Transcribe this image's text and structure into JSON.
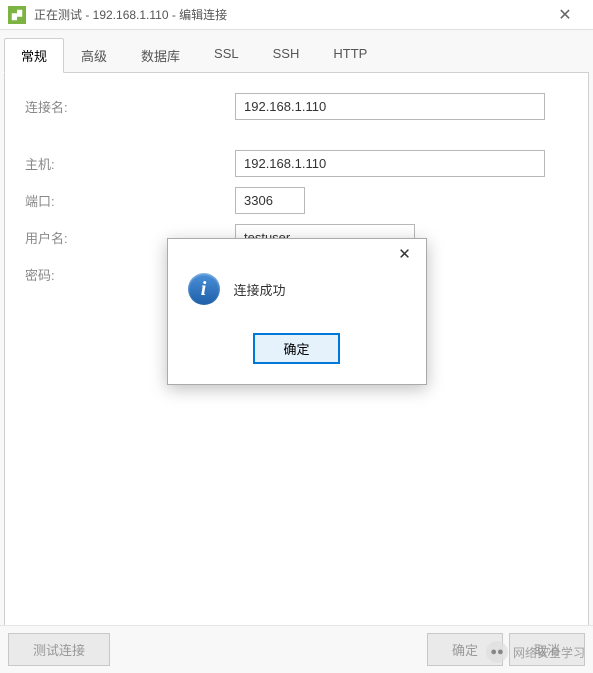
{
  "titlebar": {
    "title": "正在测试 - 192.168.1.110 - 编辑连接"
  },
  "tabs": [
    {
      "label": "常规",
      "active": true
    },
    {
      "label": "高级",
      "active": false
    },
    {
      "label": "数据库",
      "active": false
    },
    {
      "label": "SSL",
      "active": false
    },
    {
      "label": "SSH",
      "active": false
    },
    {
      "label": "HTTP",
      "active": false
    }
  ],
  "form": {
    "conn_name_label": "连接名:",
    "conn_name_value": "192.168.1.110",
    "host_label": "主机:",
    "host_value": "192.168.1.110",
    "port_label": "端口:",
    "port_value": "3306",
    "user_label": "用户名:",
    "user_value": "testuser",
    "pass_label": "密码:",
    "pass_value": "●●●●●●●●●"
  },
  "buttons": {
    "test": "测试连接",
    "ok": "确定",
    "cancel": "取消"
  },
  "modal": {
    "message": "连接成功",
    "ok": "确定"
  },
  "watermark": {
    "text": "网络安全学习"
  }
}
